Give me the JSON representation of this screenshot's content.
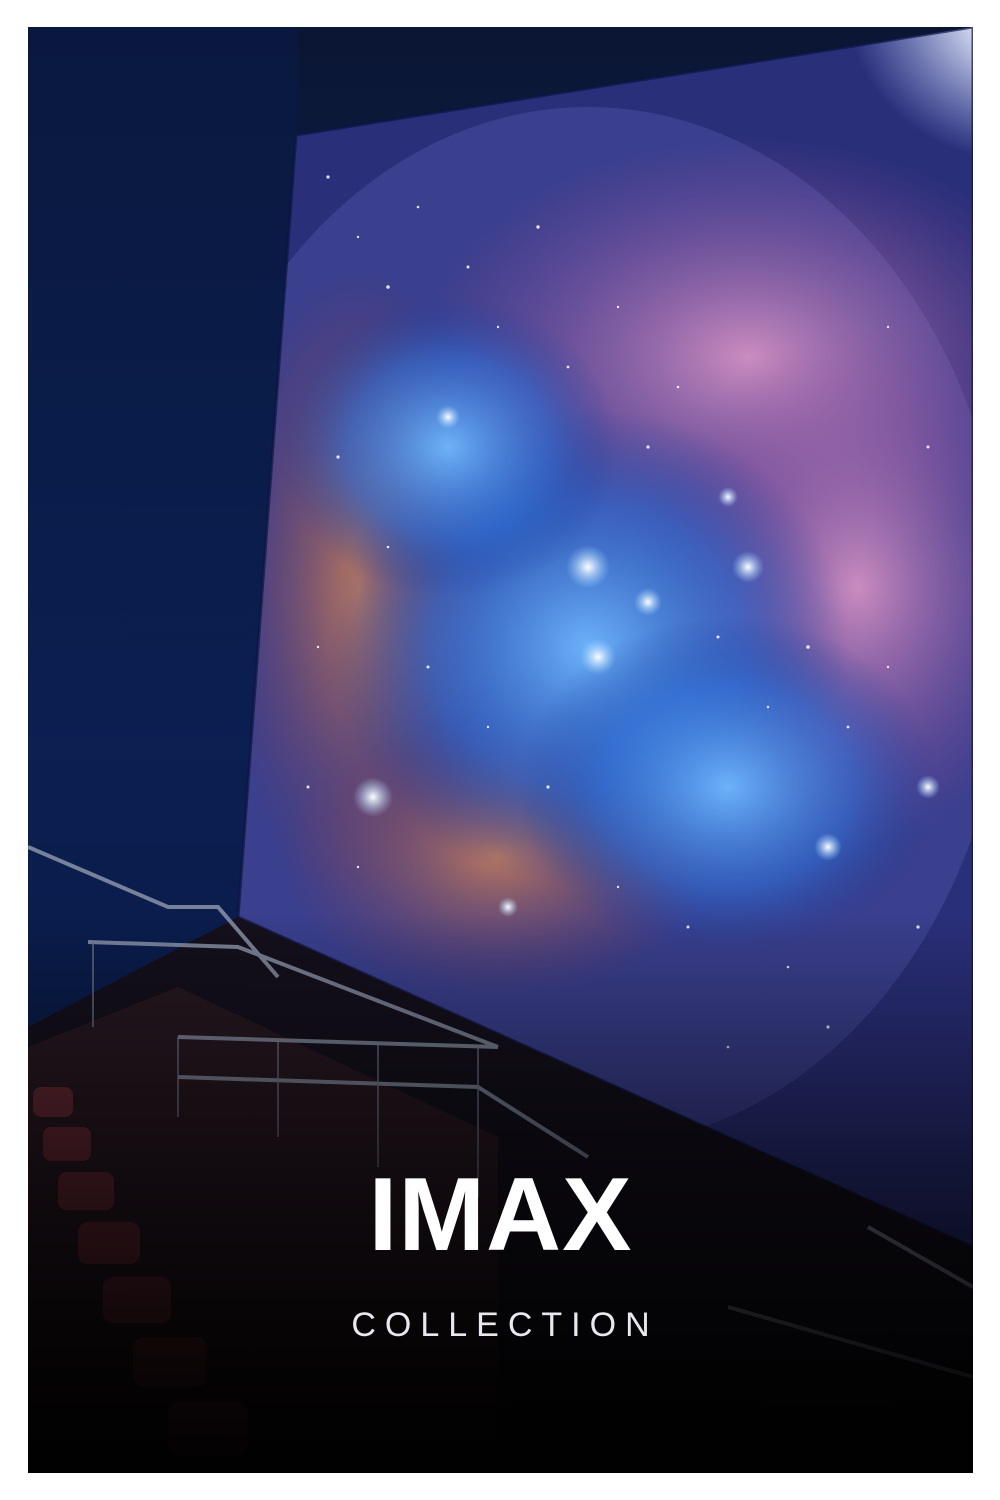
{
  "poster": {
    "title": "IMAX",
    "subtitle": "COLLECTION"
  },
  "colors": {
    "frame": "#ffffff",
    "wall": "#0b1a44",
    "nebula_blue": "#3a7bd5",
    "nebula_pink": "#c56aa8",
    "nebula_orange": "#d3774a",
    "title_text": "#ffffff"
  },
  "icons": {
    "scene": "theater-screen-nebula-image"
  }
}
